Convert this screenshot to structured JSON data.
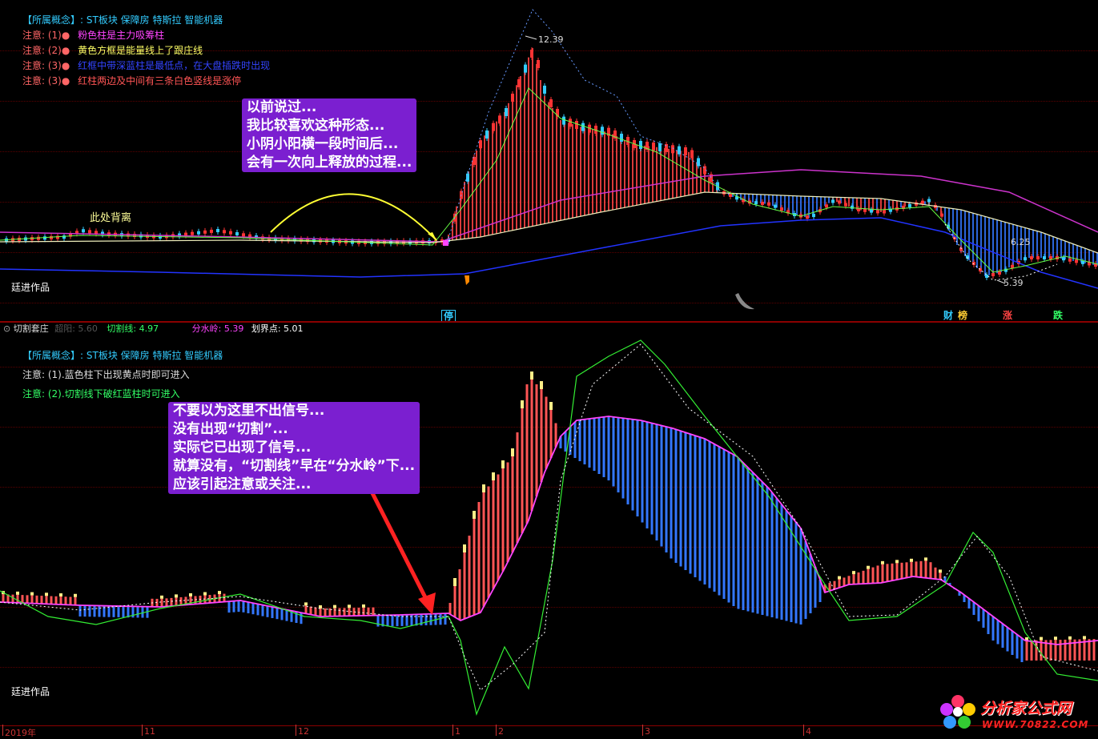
{
  "top_panel": {
    "concept_label": "【所属概念】:",
    "concept_value": "ST板块 保障房 特斯拉 智能机器",
    "notes": [
      {
        "label": "注意: (1)●",
        "text": "粉色柱是主力吸筹柱",
        "color": "#ff44ff"
      },
      {
        "label": "注意: (2)●",
        "text": "黄色方框是能量线上了跟庄线",
        "color": "#ffff66"
      },
      {
        "label": "注意: (3)●",
        "text": "红框中带深蓝柱是最低点，在大盘插跌时出现",
        "color": "#3344ff"
      },
      {
        "label": "注意: (3)●",
        "text": "红柱两边及中间有三条白色竖线是涨停",
        "color": "#ff5555"
      }
    ],
    "peak_label": "12.39",
    "low_label_1": "6.25",
    "low_label_2": "5.39",
    "divergence_label": "此处背离",
    "watermark": "廷进作品",
    "callout_lines": [
      "以前说过...",
      "我比较喜欢这种形态...",
      "小阴小阳横一段时间后...",
      "会有一次向上释放的过程..."
    ],
    "signals": [
      {
        "text": "停",
        "color": "#33ccff"
      },
      {
        "text": "财",
        "color": "#33ccff"
      },
      {
        "text": "榜",
        "color": "#ffcc33"
      },
      {
        "text": "涨",
        "color": "#ff4444"
      },
      {
        "text": "跌",
        "color": "#33ff66"
      }
    ]
  },
  "indicator_bar": {
    "name": "切割套庄",
    "item1": "超阳: 5.60",
    "item2": "切割线: 4.97",
    "item3": "分水岭: 5.39",
    "item4": "划界点: 5.01",
    "colors": {
      "item1": "#555555",
      "item2": "#33ff66",
      "item3": "#ff44ff",
      "item4": "#ffffff"
    }
  },
  "bottom_panel": {
    "concept_label": "【所属概念】:",
    "concept_value": "ST板块 保障房 特斯拉 智能机器",
    "note1": "注意: (1).蓝色柱下出现黄点时即可进入",
    "note2": "注意: (2).切割线下破红蓝柱时可进入",
    "watermark": "廷进作品",
    "callout_lines": [
      "不要以为这里不出信号...",
      "没有出现“切割”...",
      "实际它已出现了信号...",
      "就算没有，“切割线”早在“分水岭”下...",
      "应该引起注意或关注..."
    ]
  },
  "x_axis": {
    "labels": [
      "2019年",
      "11",
      "12",
      "1",
      "2",
      "3",
      "4"
    ]
  },
  "logo": {
    "name": "分析家公式网",
    "url_text": "WWW.70822.COM"
  },
  "colors": {
    "background": "#000000",
    "up_bar": "#ff4444",
    "down_bar": "#3377ff",
    "cyan": "#33ccff",
    "magenta": "#ff44ff",
    "callout": "#7b1fd0"
  }
}
